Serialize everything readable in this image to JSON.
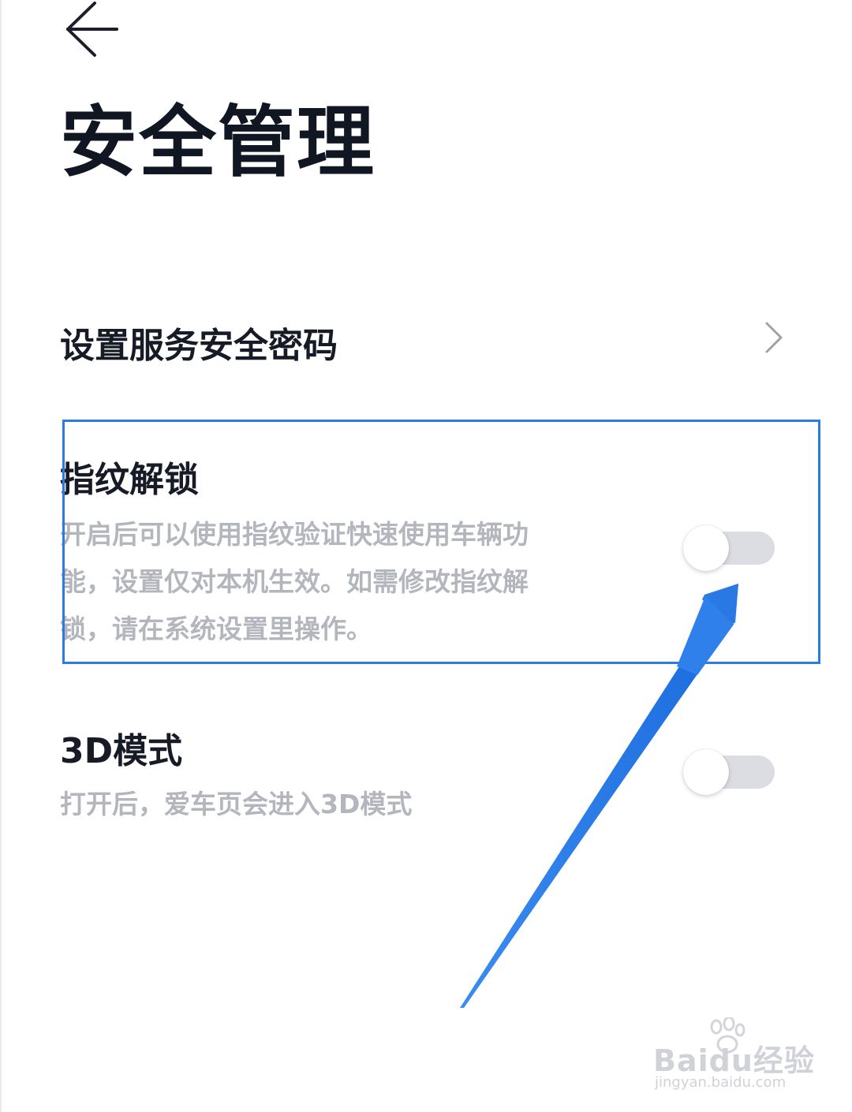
{
  "header": {
    "back_icon": "arrow-left-icon",
    "title": "安全管理"
  },
  "settings": {
    "password": {
      "label": "设置服务安全密码",
      "icon": "chevron-right-icon"
    },
    "fingerprint": {
      "title": "指纹解锁",
      "desc_lines": [
        "开启后可以使用指纹验证快速使用车辆功",
        "能，设置仅对本机生效。如需修改指纹解",
        "锁，请在系统设置里操作。"
      ],
      "enabled": false
    },
    "mode3d": {
      "title": "3D模式",
      "desc": "打开后，爱车页会进入3D模式",
      "enabled": false
    }
  },
  "annotation": {
    "color": "#2b7ae6"
  },
  "watermark": {
    "brand_left": "Bai",
    "brand_right": "du",
    "brand_cn": "经验",
    "url": "jingyan.baidu.com"
  }
}
